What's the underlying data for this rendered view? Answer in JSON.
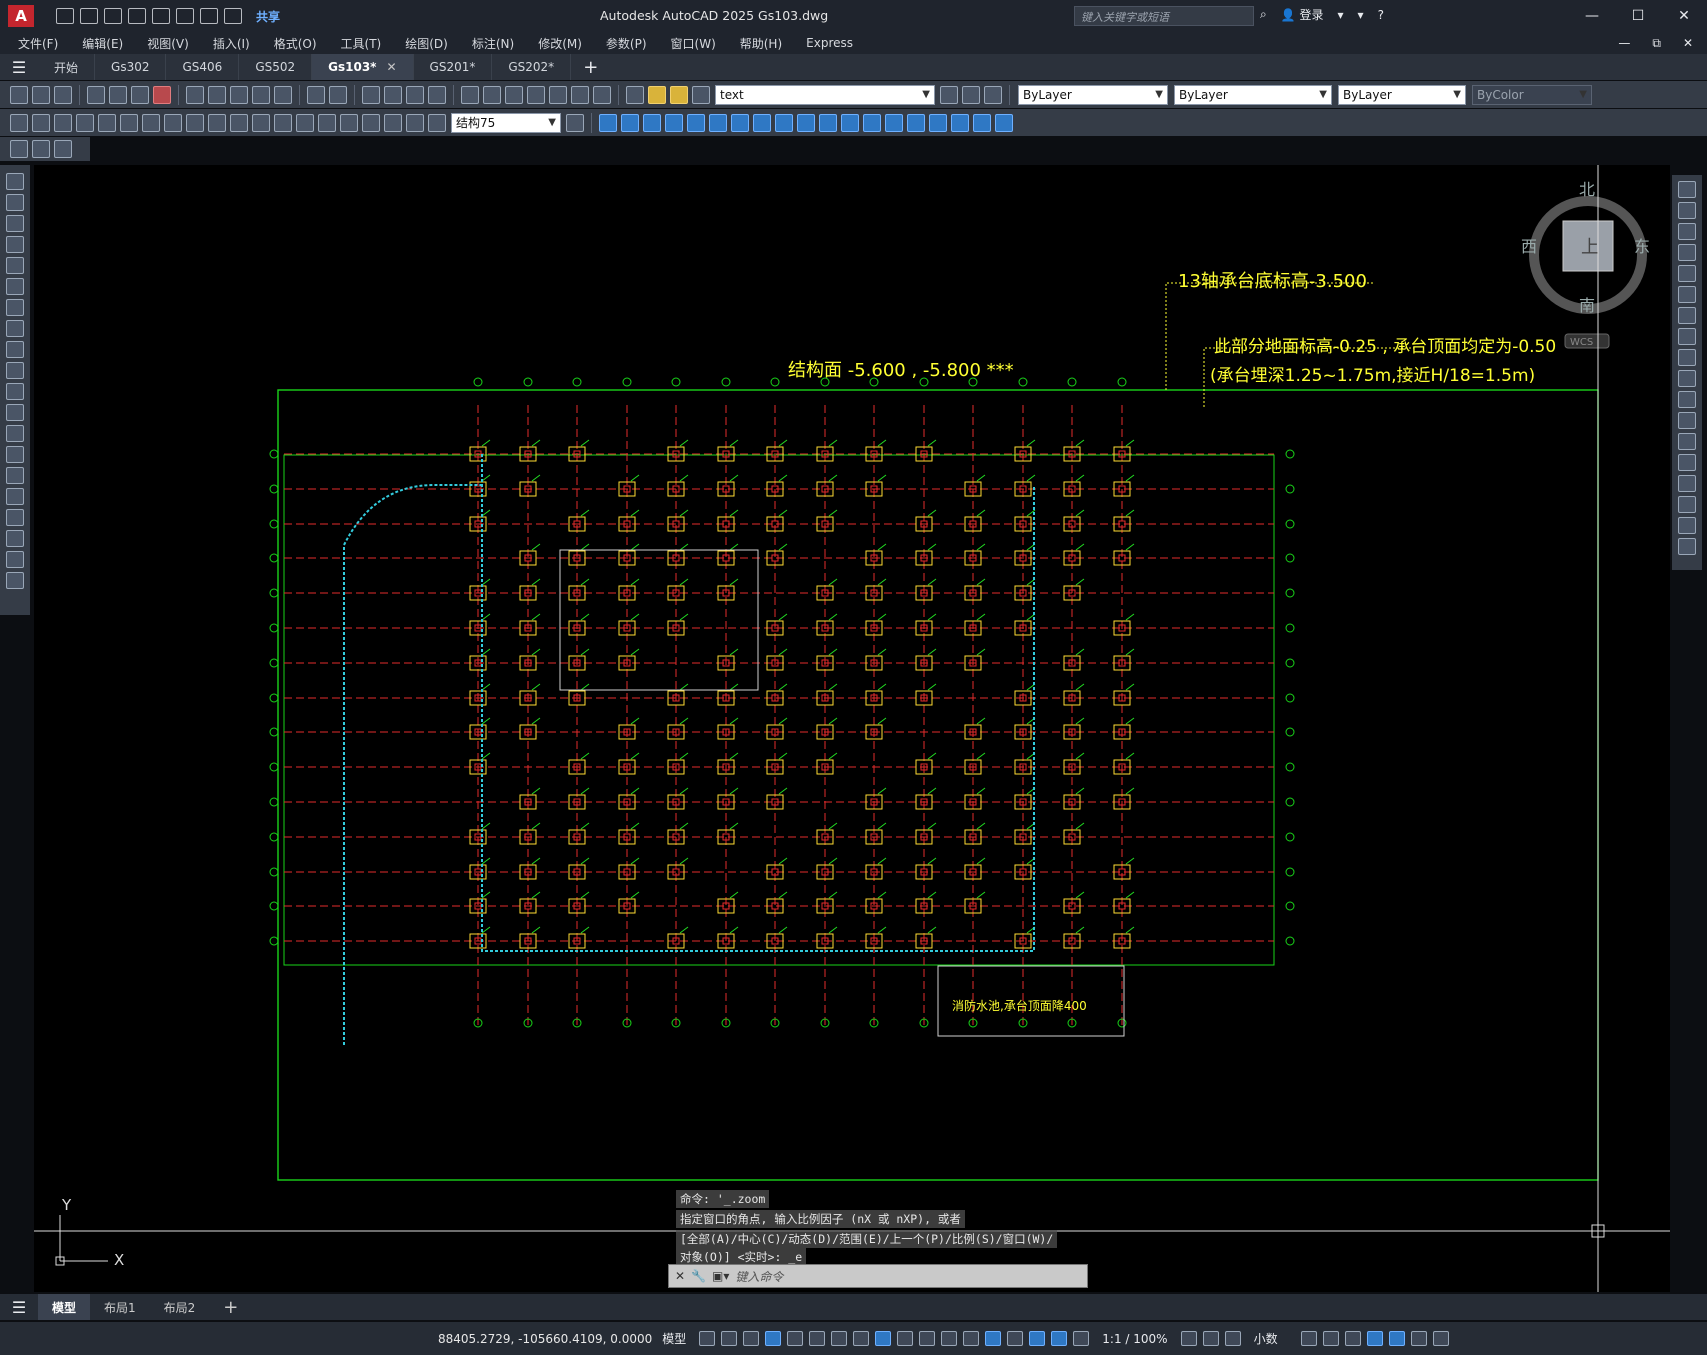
{
  "titlebar": {
    "app_letter": "A",
    "share": "共享",
    "title": "Autodesk AutoCAD 2025    Gs103.dwg",
    "search_placeholder": "键入关键字或短语",
    "login": "登录",
    "win": [
      "—",
      "☐",
      "✕"
    ]
  },
  "menubar": {
    "items": [
      "文件(F)",
      "编辑(E)",
      "视图(V)",
      "插入(I)",
      "格式(O)",
      "工具(T)",
      "绘图(D)",
      "标注(N)",
      "修改(M)",
      "参数(P)",
      "窗口(W)",
      "帮助(H)",
      "Express"
    ],
    "controls": [
      "—",
      "⧉",
      "✕"
    ]
  },
  "tabs": {
    "items": [
      {
        "label": "开始"
      },
      {
        "label": "Gs302"
      },
      {
        "label": "GS406"
      },
      {
        "label": "GS502"
      },
      {
        "label": "Gs103*"
      },
      {
        "label": "GS201*"
      },
      {
        "label": "GS202*"
      }
    ],
    "active": "Gs103*",
    "add": "+"
  },
  "toolbar": {
    "layer_text": "text",
    "color": "ByLayer",
    "linetype": "ByLayer",
    "lineweight": "ByLayer",
    "plotstyle": "ByColor",
    "dimstyle": "结构75"
  },
  "viewcube": {
    "north": "北",
    "south": "南",
    "east": "东",
    "west": "西",
    "top": "上",
    "wcs": "WCS"
  },
  "drawing": {
    "note_top": "13轴承台底标高-3.500",
    "note_struct": "结构面  -5.600 , -5.800 ***",
    "note_partial": "此部分地面标高-0.25 , 承台顶面均定为-0.50",
    "note_cap": "(承台埋深1.25~1.75m,接近H/18=1.5m)",
    "note_pool": "消防水池,承台顶面降400",
    "ucs_x": "X",
    "ucs_y": "Y",
    "colors": {
      "grid": "#e22c2c",
      "frame": "#19d419",
      "note": "#ffff33",
      "cyan": "#33ccdd"
    }
  },
  "command": {
    "line1": "命令: '_.zoom",
    "line2": "指定窗口的角点, 输入比例因子 (nX 或 nXP), 或者",
    "line3": "[全部(A)/中心(C)/动态(D)/范围(E)/上一个(P)/比例(S)/窗口(W)/",
    "line4": "对象(O)] <实时>: _e",
    "placeholder": "键入命令"
  },
  "bottomtabs": {
    "items": [
      "模型",
      "布局1",
      "布局2"
    ],
    "add": "+"
  },
  "status": {
    "coords": "88405.2729, -105660.4109, 0.0000",
    "model": "模型",
    "scale": "1:1 / 100%",
    "units": "小数"
  }
}
